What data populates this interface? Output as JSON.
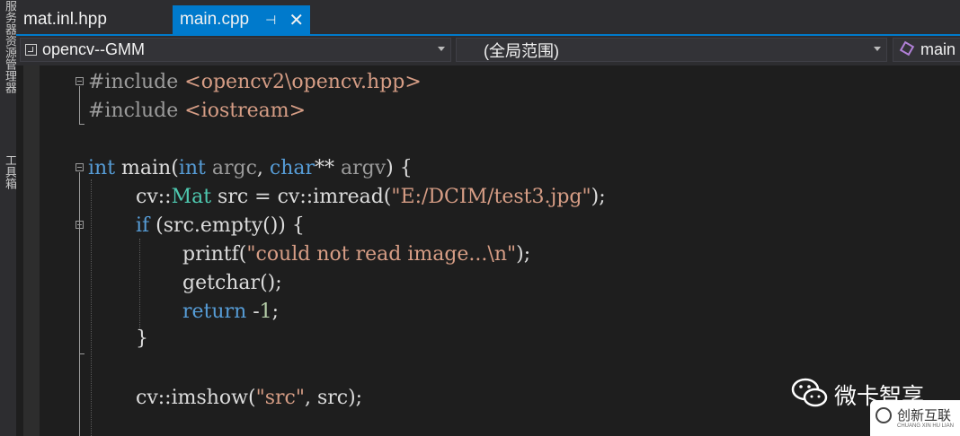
{
  "left_strip": {
    "label_1": "服务器资源管理器",
    "label_2": "工具箱"
  },
  "tabs": [
    {
      "label": "mat.inl.hpp",
      "active": false
    },
    {
      "label": "main.cpp",
      "active": true,
      "pin": "⊣",
      "close": "✕"
    }
  ],
  "navbar": {
    "project": "opencv--GMM",
    "scope": "(全局范围)",
    "member": "main"
  },
  "code": {
    "l1": {
      "directive": "#include",
      "header": "<opencv2\\opencv.hpp>"
    },
    "l2": {
      "directive": "#include",
      "header": "<iostream>"
    },
    "l4": {
      "kw": "int",
      "name": " main(",
      "p_kw1": "int",
      "p_n1": " argc",
      "comma": ", ",
      "p_kw2": "char",
      "stars": "**",
      "p_n2": " argv",
      "close": ") {"
    },
    "l5": {
      "ns1": "cv::",
      "type": "Mat",
      "mid": " src = cv::imread(",
      "str": "\"E:/DCIM/test3.jpg\"",
      "end": ");"
    },
    "l6": {
      "kw": "if",
      "rest": " (src.empty()) {"
    },
    "l7": {
      "fn": "printf(",
      "str": "\"could not read image...\\n\"",
      "end": ");"
    },
    "l8": {
      "text": "getchar();"
    },
    "l9": {
      "kw": "return",
      "minus": " -",
      "num": "1",
      "end": ";"
    },
    "l10": {
      "text": "}"
    },
    "l12": {
      "pre": "cv::imshow(",
      "str": "\"src\"",
      "end": ", src);"
    }
  },
  "watermark": {
    "text": "微卡智享",
    "badge": "创新互联",
    "badge_sub": "CHUANG XIN HU LIAN"
  },
  "colors": {
    "accent": "#007acc",
    "keyword": "#569cd6",
    "string": "#d69d85",
    "type": "#4ec9b0",
    "background": "#1e1e1e"
  }
}
